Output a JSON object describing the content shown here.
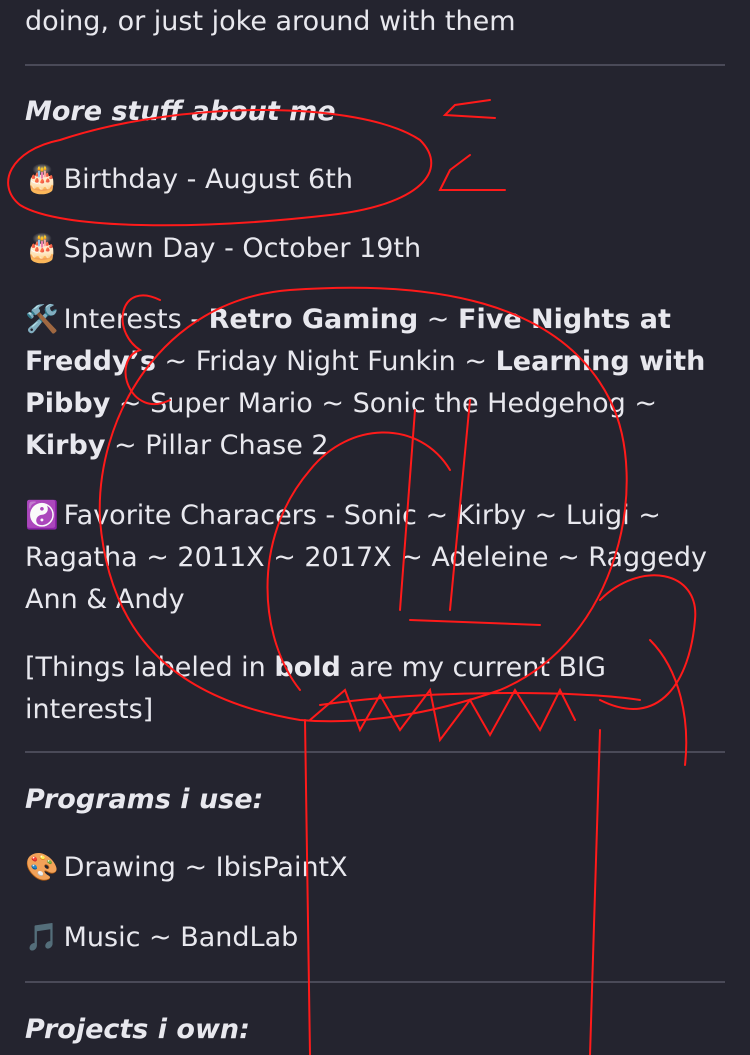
{
  "intro_tail": "doing, or just joke around with them",
  "more_stuff": {
    "heading": "More stuff about me",
    "birthday_icon": "🎂",
    "birthday": "Birthday - August 6th",
    "spawn_icon": "🎂",
    "spawn_day": "Spawn Day - October 19th",
    "interests_icon": "🛠️",
    "interests_label": "Interests -",
    "interests": {
      "i1": "Retro Gaming",
      "sep": " ~ ",
      "i2": "Five Nights at Freddy’s",
      "i3": "Friday Night Funkin",
      "i4": "Learning with Pibby",
      "i5": "Super Mario",
      "i6": "Sonic the Hedgehog",
      "i7": "Kirby",
      "i8": "Pillar Chase 2"
    },
    "characters_icon": "☯️",
    "characters": "Favorite Characers - Sonic ~ Kirby ~ Luigi ~ Ragatha ~ 2011X ~ 2017X ~ Adeleine ~ Raggedy Ann & Andy",
    "note_pre": "[Things labeled in ",
    "note_bold": "bold",
    "note_post": " are my current BIG interests]"
  },
  "programs": {
    "heading": "Programs i use:",
    "drawing_icon": "🎨",
    "drawing": "Drawing ~ IbisPaintX",
    "music_icon": "🎵",
    "music": "Music ~ BandLab"
  },
  "projects": {
    "heading": "Projects i own:"
  },
  "colors": {
    "background": "#24242f",
    "text": "#e8e8ee",
    "divider": "#4a4a58",
    "scribble": "#ff1a1a"
  }
}
